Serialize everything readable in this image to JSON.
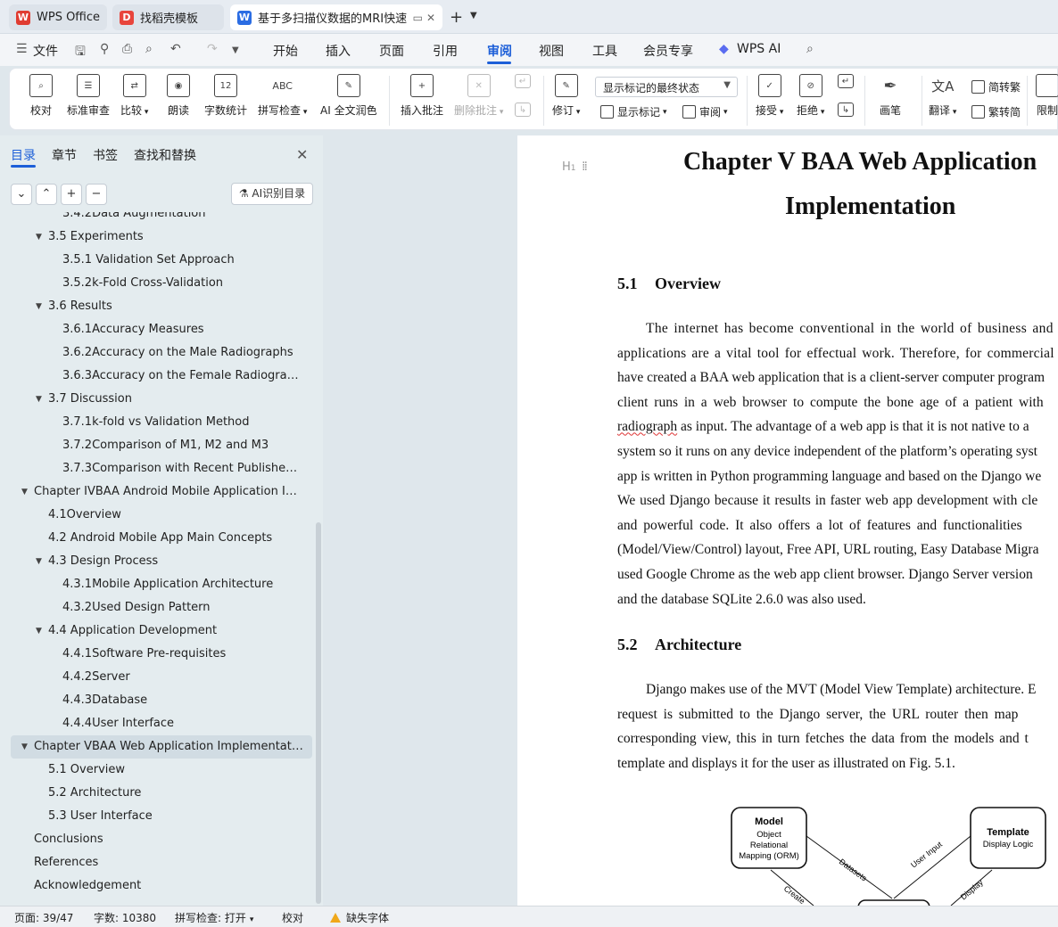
{
  "tabs": {
    "wps": "WPS Office",
    "templates": "找稻壳模板",
    "doc": "基于多扫描仪数据的MRI快速"
  },
  "menu": {
    "file": "文件",
    "items": [
      "开始",
      "插入",
      "页面",
      "引用",
      "审阅",
      "视图",
      "工具",
      "会员专享"
    ],
    "active": "审阅",
    "ai": "WPS AI"
  },
  "ribbon": {
    "proofread": "校对",
    "standard_review": "标准审查",
    "compare": "比较",
    "read_aloud": "朗读",
    "word_count": "字数统计",
    "spell_check": "拼写检查",
    "ai_polish": "AI 全文润色",
    "insert_comment": "插入批注",
    "delete_comment": "删除批注",
    "revise": "修订",
    "markup_mode": "显示标记的最终状态",
    "show_markup": "显示标记",
    "review": "审阅",
    "accept": "接受",
    "reject": "拒绝",
    "pen": "画笔",
    "translate": "翻译",
    "to_traditional": "简转繁",
    "to_simplified": "繁转简",
    "restrict": "限制"
  },
  "nav": {
    "tabs": [
      "目录",
      "章节",
      "书签",
      "查找和替换"
    ],
    "active": "目录",
    "ai_toc": "AI识别目录",
    "toc": [
      {
        "level": 3,
        "text": "3.4.2Data Augmentation"
      },
      {
        "level": 2,
        "text": "3.5 Experiments"
      },
      {
        "level": 3,
        "text": "3.5.1 Validation Set Approach"
      },
      {
        "level": 3,
        "text": "3.5.2k-Fold Cross-Validation"
      },
      {
        "level": 2,
        "text": "3.6 Results"
      },
      {
        "level": 3,
        "text": "3.6.1Accuracy Measures"
      },
      {
        "level": 3,
        "text": "3.6.2Accuracy on the Male Radiographs"
      },
      {
        "level": 3,
        "text": "3.6.3Accuracy on the Female Radiographs"
      },
      {
        "level": 2,
        "text": "3.7 Discussion"
      },
      {
        "level": 3,
        "text": "3.7.1k-fold vs Validation Method"
      },
      {
        "level": 3,
        "text": "3.7.2Comparison of M1, M2 and M3"
      },
      {
        "level": 3,
        "text": "3.7.3Comparison with Recent Published Wor..."
      },
      {
        "level": 1,
        "text": "Chapter IVBAA Android Mobile Application Imple..."
      },
      {
        "level": 2,
        "text": "4.1Overview"
      },
      {
        "level": 2,
        "text": "4.2 Android Mobile App Main Concepts"
      },
      {
        "level": 2,
        "text": "4.3 Design Process"
      },
      {
        "level": 3,
        "text": "4.3.1Mobile Application Architecture"
      },
      {
        "level": 3,
        "text": "4.3.2Used Design Pattern"
      },
      {
        "level": 2,
        "text": "4.4 Application Development"
      },
      {
        "level": 3,
        "text": "4.4.1Software Pre-requisites"
      },
      {
        "level": 3,
        "text": "4.4.2Server"
      },
      {
        "level": 3,
        "text": "4.4.3Database"
      },
      {
        "level": 3,
        "text": "4.4.4User Interface"
      },
      {
        "level": 1,
        "text": "Chapter VBAA Web Application Implementation",
        "selected": true
      },
      {
        "level": 2,
        "text": "5.1 Overview"
      },
      {
        "level": 2,
        "text": "5.2 Architecture"
      },
      {
        "level": 2,
        "text": "5.3 User Interface"
      },
      {
        "level": 1,
        "text": "Conclusions"
      },
      {
        "level": 1,
        "text": "References"
      },
      {
        "level": 1,
        "text": "Acknowledgement"
      }
    ]
  },
  "doc": {
    "heading_marker": "H",
    "chapter_title_line1": "Chapter V  BAA Web Application",
    "chapter_title_line2": "Implementation",
    "sec1_num": "5.1",
    "sec1_title": "Overview",
    "sec1_lines": [
      "The internet has become conventional in the world of business and",
      "applications are a vital tool for effectual work. Therefore, for commercial",
      "have created a BAA web application that is a client-server computer program",
      "client runs in a web browser to compute the bone age of a patient with",
      "radiograph",
      " as input. The advantage of a web app is that it is not native to a",
      "system so it runs on any device independent of the platform’s operating syst",
      "app is written in Python programming language and based on the Django we",
      "We used Django because it results in faster web app development with cle",
      "and powerful code. It also offers a lot of features and functionalities",
      "(Model/View/Control) layout, Free API, URL routing, Easy Database Migra",
      "used Google Chrome as the web app client browser. Django Server version",
      "and the database SQLite 2.6.0 was also used."
    ],
    "sec2_num": "5.2",
    "sec2_title": "Architecture",
    "sec2_lines": [
      "Django makes use of the MVT (Model View Template) architecture. E",
      "request is submitted to the Django server, the URL router then map",
      "corresponding view, this in turn fetches the data from the models and t",
      "template and displays it for the user as illustrated on Fig. 5.1."
    ],
    "diagram": {
      "model_title": "Model",
      "model_lines": [
        "Object",
        "Relational",
        "Mapping (ORM)"
      ],
      "template_title": "Template",
      "template_lines": [
        "Display Logic"
      ],
      "edge_datasets": "Datasets",
      "edge_user_input": "User Input",
      "edge_create": "Create",
      "edge_display": "Display"
    }
  },
  "status": {
    "page": "页面: 39/47",
    "words": "字数: 10380",
    "spell": "拼写检查: 打开",
    "proof": "校对",
    "missing_font": "缺失字体"
  }
}
